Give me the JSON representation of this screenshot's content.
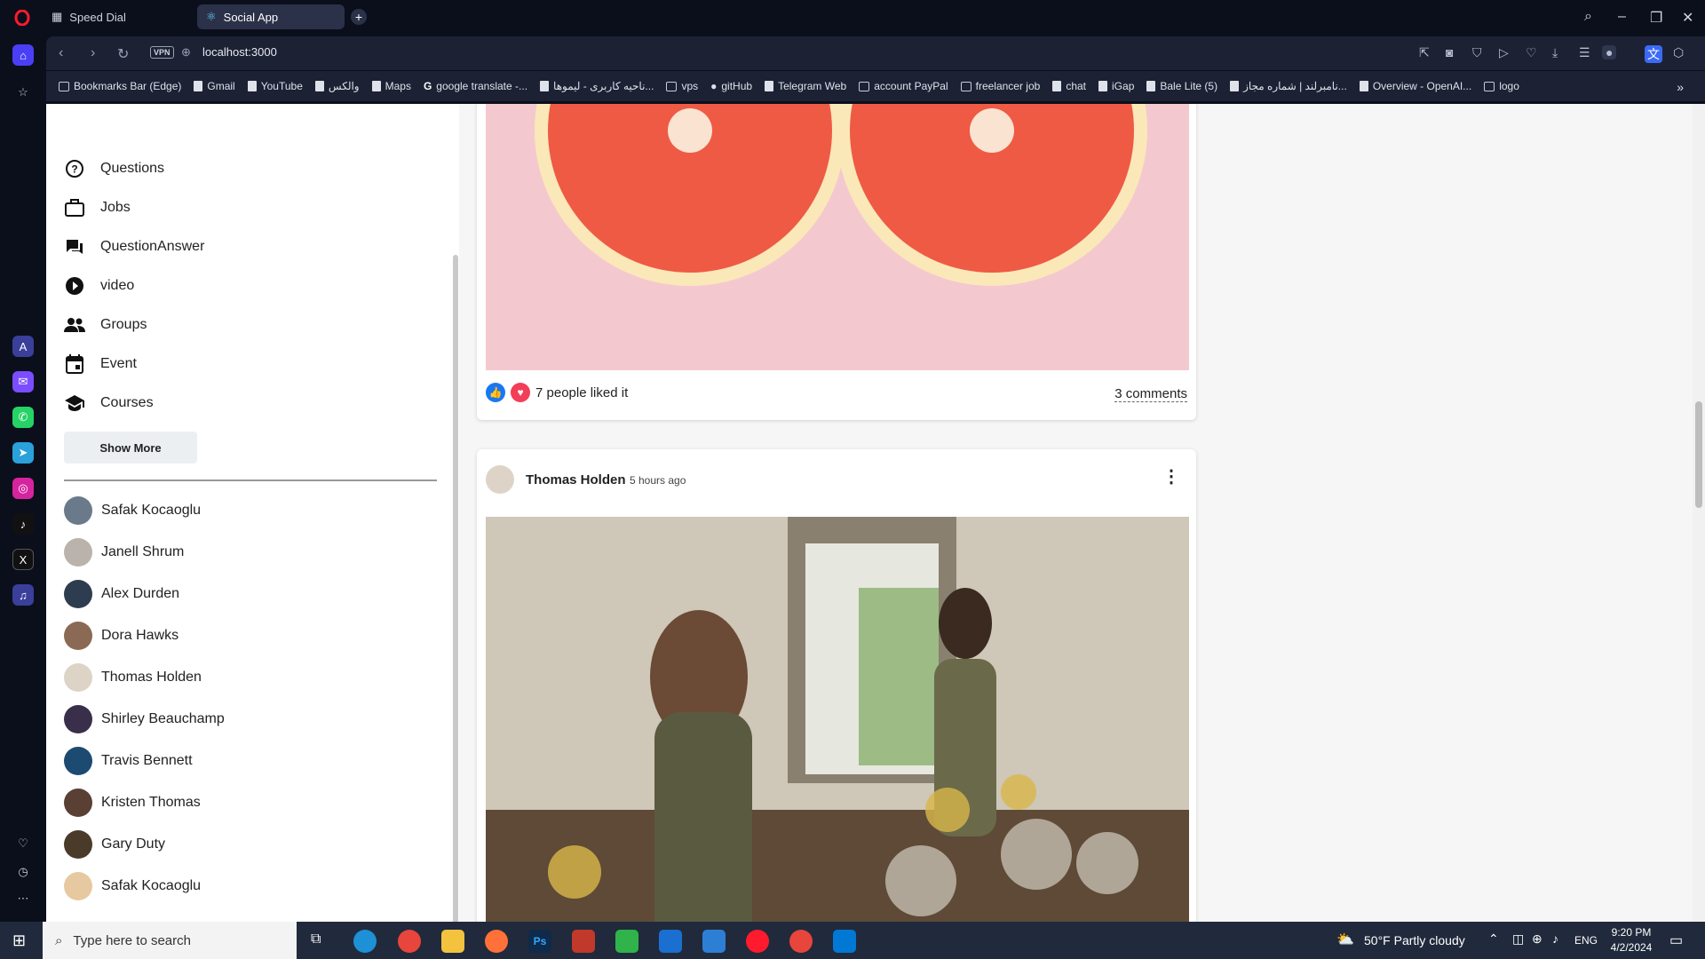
{
  "browser": {
    "tabs": [
      {
        "label": "Speed Dial"
      },
      {
        "label": "Social App"
      }
    ],
    "url": "localhost:3000",
    "vpn_label": "VPN",
    "bookmarks": [
      "Bookmarks Bar (Edge)",
      "Gmail",
      "YouTube",
      "والکس",
      "Maps",
      "google translate -...",
      "ناحیه کاربری - لیموها...",
      "vps",
      "gitHub",
      "Telegram Web",
      "account PayPal",
      "freelancer job",
      "chat",
      "iGap",
      "Bale Lite (5)",
      "نامبرلند | شماره مجاز...",
      "Overview - OpenAI...",
      "logo"
    ]
  },
  "sidebar": {
    "nav": [
      {
        "label": "Questions",
        "icon": "help-circle-icon"
      },
      {
        "label": "Jobs",
        "icon": "briefcase-icon"
      },
      {
        "label": "QuestionAnswer",
        "icon": "chat-bubbles-icon"
      },
      {
        "label": "video",
        "icon": "play-circle-icon"
      },
      {
        "label": "Groups",
        "icon": "people-icon"
      },
      {
        "label": "Event",
        "icon": "calendar-icon"
      },
      {
        "label": "Courses",
        "icon": "school-icon"
      }
    ],
    "show_more": "Show More",
    "friends": [
      "Safak Kocaoglu",
      "Janell Shrum",
      "Alex Durden",
      "Dora Hawks",
      "Thomas Holden",
      "Shirley Beauchamp",
      "Travis Bennett",
      "Kristen Thomas",
      "Gary Duty",
      "Safak Kocaoglu"
    ]
  },
  "feed": {
    "post1": {
      "likes_text": "7 people liked it",
      "comments_text": "3 comments"
    },
    "post2": {
      "author": "Thomas Holden",
      "time": "5 hours ago"
    }
  },
  "taskbar": {
    "search_placeholder": "Type here to search",
    "weather": "50°F  Partly cloudy",
    "lang": "ENG",
    "time": "9:20 PM",
    "date": "4/2/2024"
  }
}
